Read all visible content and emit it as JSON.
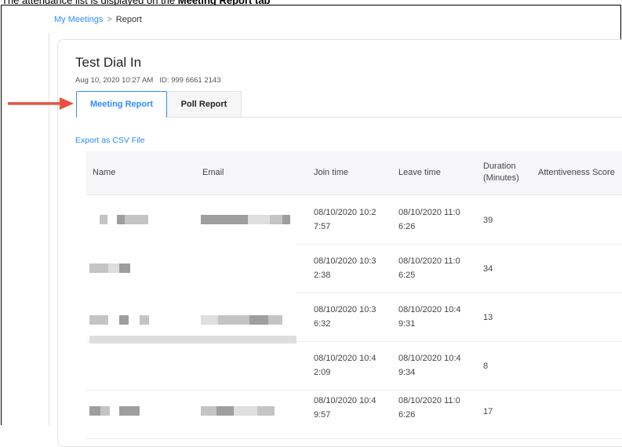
{
  "caption": {
    "prefix": "The attendance list is displayed on the",
    "bold": "Meeting Report tab"
  },
  "breadcrumb": {
    "link": "My Meetings",
    "separator": ">",
    "current": "Report"
  },
  "meeting": {
    "title": "Test Dial In",
    "datetime": "Aug 10, 2020 10:27 AM",
    "id_label": "ID: 999 6661 2143"
  },
  "tabs": {
    "active": "Meeting Report",
    "inactive": "Poll Report"
  },
  "colors": {
    "accent": "#2d8cff",
    "arrow": "#e8533f"
  },
  "export_label": "Export as CSV File",
  "table": {
    "headers": {
      "name": "Name",
      "email": "Email",
      "join": "Join time",
      "leave": "Leave time",
      "duration_1": "Duration",
      "duration_2": "(Minutes)",
      "attentiveness": "Attentiveness Score"
    },
    "rows": [
      {
        "join_1": "08/10/2020 10:2",
        "join_2": "7:57",
        "leave_1": "08/10/2020 11:0",
        "leave_2": "6:26",
        "duration": "39"
      },
      {
        "join_1": "08/10/2020 10:3",
        "join_2": "2:38",
        "leave_1": "08/10/2020 11:0",
        "leave_2": "6:25",
        "duration": "34"
      },
      {
        "join_1": "08/10/2020 10:3",
        "join_2": "6:32",
        "leave_1": "08/10/2020 10:4",
        "leave_2": "9:31",
        "duration": "13"
      },
      {
        "join_1": "08/10/2020 10:4",
        "join_2": "2:09",
        "leave_1": "08/10/2020 10:4",
        "leave_2": "9:34",
        "duration": "8"
      },
      {
        "join_1": "08/10/2020 10:4",
        "join_2": "9:57",
        "leave_1": "08/10/2020 11:0",
        "leave_2": "6:26",
        "duration": "17"
      }
    ]
  }
}
